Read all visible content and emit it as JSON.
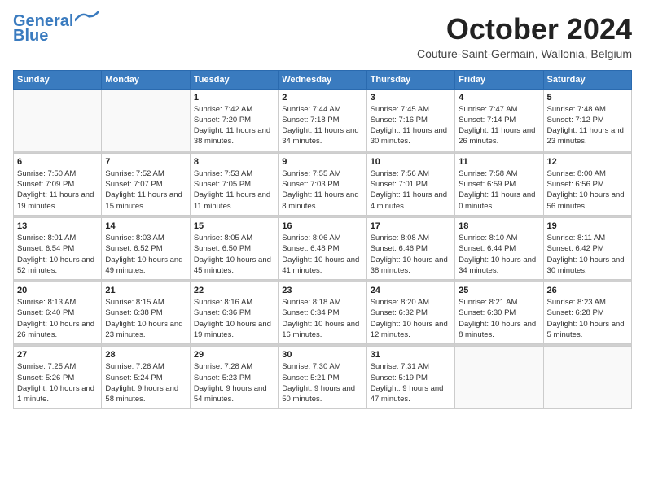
{
  "header": {
    "logo_line1": "General",
    "logo_line2": "Blue",
    "month_title": "October 2024",
    "subtitle": "Couture-Saint-Germain, Wallonia, Belgium"
  },
  "days_of_week": [
    "Sunday",
    "Monday",
    "Tuesday",
    "Wednesday",
    "Thursday",
    "Friday",
    "Saturday"
  ],
  "weeks": [
    [
      {
        "day": "",
        "info": ""
      },
      {
        "day": "",
        "info": ""
      },
      {
        "day": "1",
        "info": "Sunrise: 7:42 AM\nSunset: 7:20 PM\nDaylight: 11 hours and 38 minutes."
      },
      {
        "day": "2",
        "info": "Sunrise: 7:44 AM\nSunset: 7:18 PM\nDaylight: 11 hours and 34 minutes."
      },
      {
        "day": "3",
        "info": "Sunrise: 7:45 AM\nSunset: 7:16 PM\nDaylight: 11 hours and 30 minutes."
      },
      {
        "day": "4",
        "info": "Sunrise: 7:47 AM\nSunset: 7:14 PM\nDaylight: 11 hours and 26 minutes."
      },
      {
        "day": "5",
        "info": "Sunrise: 7:48 AM\nSunset: 7:12 PM\nDaylight: 11 hours and 23 minutes."
      }
    ],
    [
      {
        "day": "6",
        "info": "Sunrise: 7:50 AM\nSunset: 7:09 PM\nDaylight: 11 hours and 19 minutes."
      },
      {
        "day": "7",
        "info": "Sunrise: 7:52 AM\nSunset: 7:07 PM\nDaylight: 11 hours and 15 minutes."
      },
      {
        "day": "8",
        "info": "Sunrise: 7:53 AM\nSunset: 7:05 PM\nDaylight: 11 hours and 11 minutes."
      },
      {
        "day": "9",
        "info": "Sunrise: 7:55 AM\nSunset: 7:03 PM\nDaylight: 11 hours and 8 minutes."
      },
      {
        "day": "10",
        "info": "Sunrise: 7:56 AM\nSunset: 7:01 PM\nDaylight: 11 hours and 4 minutes."
      },
      {
        "day": "11",
        "info": "Sunrise: 7:58 AM\nSunset: 6:59 PM\nDaylight: 11 hours and 0 minutes."
      },
      {
        "day": "12",
        "info": "Sunrise: 8:00 AM\nSunset: 6:56 PM\nDaylight: 10 hours and 56 minutes."
      }
    ],
    [
      {
        "day": "13",
        "info": "Sunrise: 8:01 AM\nSunset: 6:54 PM\nDaylight: 10 hours and 52 minutes."
      },
      {
        "day": "14",
        "info": "Sunrise: 8:03 AM\nSunset: 6:52 PM\nDaylight: 10 hours and 49 minutes."
      },
      {
        "day": "15",
        "info": "Sunrise: 8:05 AM\nSunset: 6:50 PM\nDaylight: 10 hours and 45 minutes."
      },
      {
        "day": "16",
        "info": "Sunrise: 8:06 AM\nSunset: 6:48 PM\nDaylight: 10 hours and 41 minutes."
      },
      {
        "day": "17",
        "info": "Sunrise: 8:08 AM\nSunset: 6:46 PM\nDaylight: 10 hours and 38 minutes."
      },
      {
        "day": "18",
        "info": "Sunrise: 8:10 AM\nSunset: 6:44 PM\nDaylight: 10 hours and 34 minutes."
      },
      {
        "day": "19",
        "info": "Sunrise: 8:11 AM\nSunset: 6:42 PM\nDaylight: 10 hours and 30 minutes."
      }
    ],
    [
      {
        "day": "20",
        "info": "Sunrise: 8:13 AM\nSunset: 6:40 PM\nDaylight: 10 hours and 26 minutes."
      },
      {
        "day": "21",
        "info": "Sunrise: 8:15 AM\nSunset: 6:38 PM\nDaylight: 10 hours and 23 minutes."
      },
      {
        "day": "22",
        "info": "Sunrise: 8:16 AM\nSunset: 6:36 PM\nDaylight: 10 hours and 19 minutes."
      },
      {
        "day": "23",
        "info": "Sunrise: 8:18 AM\nSunset: 6:34 PM\nDaylight: 10 hours and 16 minutes."
      },
      {
        "day": "24",
        "info": "Sunrise: 8:20 AM\nSunset: 6:32 PM\nDaylight: 10 hours and 12 minutes."
      },
      {
        "day": "25",
        "info": "Sunrise: 8:21 AM\nSunset: 6:30 PM\nDaylight: 10 hours and 8 minutes."
      },
      {
        "day": "26",
        "info": "Sunrise: 8:23 AM\nSunset: 6:28 PM\nDaylight: 10 hours and 5 minutes."
      }
    ],
    [
      {
        "day": "27",
        "info": "Sunrise: 7:25 AM\nSunset: 5:26 PM\nDaylight: 10 hours and 1 minute."
      },
      {
        "day": "28",
        "info": "Sunrise: 7:26 AM\nSunset: 5:24 PM\nDaylight: 9 hours and 58 minutes."
      },
      {
        "day": "29",
        "info": "Sunrise: 7:28 AM\nSunset: 5:23 PM\nDaylight: 9 hours and 54 minutes."
      },
      {
        "day": "30",
        "info": "Sunrise: 7:30 AM\nSunset: 5:21 PM\nDaylight: 9 hours and 50 minutes."
      },
      {
        "day": "31",
        "info": "Sunrise: 7:31 AM\nSunset: 5:19 PM\nDaylight: 9 hours and 47 minutes."
      },
      {
        "day": "",
        "info": ""
      },
      {
        "day": "",
        "info": ""
      }
    ]
  ]
}
